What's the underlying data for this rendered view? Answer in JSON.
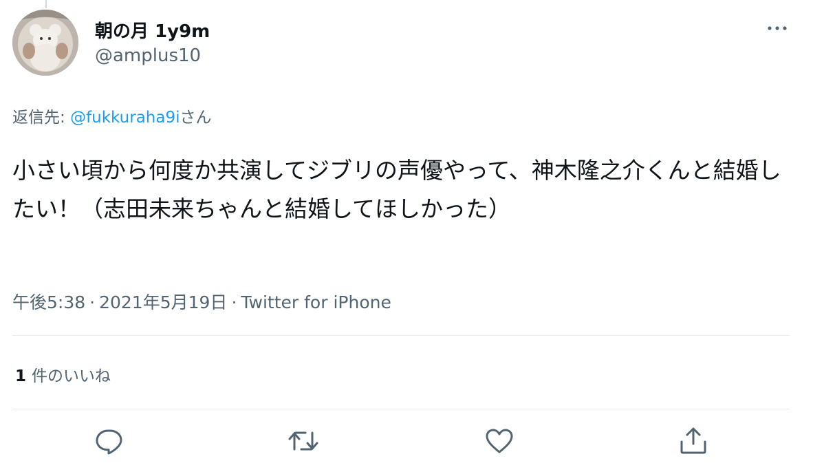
{
  "tweet": {
    "display_name": "朝の月 1y9m",
    "handle": "@amplus10",
    "reply_prefix": "返信先: ",
    "reply_mention": "@fukkuraha9i",
    "reply_suffix": "さん",
    "text": "小さい頃から何度か共演してジブリの声優やって、神木隆之介くんと結婚したい！（志田未来ちゃんと結婚してほしかった）",
    "time": "午後5:38",
    "separator": "·",
    "date": "2021年5月19日",
    "source": "Twitter for iPhone",
    "like_count": "1",
    "like_label": "件のいいね"
  },
  "icons": {
    "more": "more-horizontal-icon",
    "reply": "reply-bubble-icon",
    "retweet": "retweet-icon",
    "like": "heart-icon",
    "share": "share-upload-icon"
  },
  "colors": {
    "link": "#1d9bf0",
    "secondary_text": "#536471",
    "primary_text": "#0f1419",
    "divider": "#e6ecf0"
  }
}
